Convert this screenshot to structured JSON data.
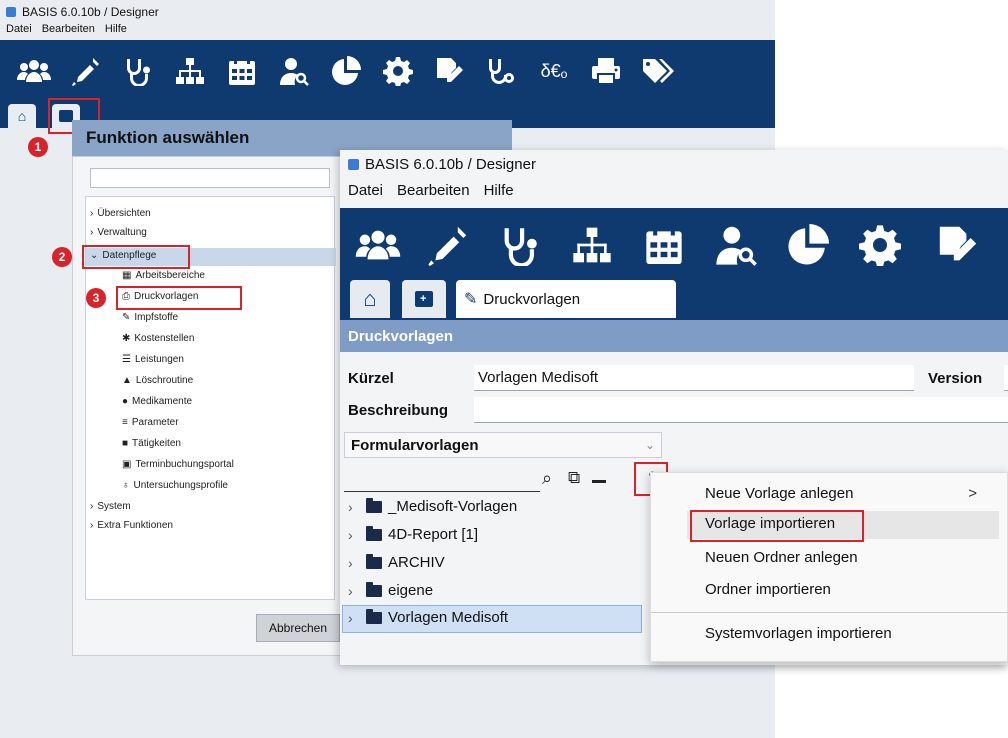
{
  "colors": {
    "toolbar": "#0e3a70",
    "highlight": "#d8232a",
    "panel": "#8aa4c7"
  },
  "back_window": {
    "title": "BASIS 6.0.10b / Designer",
    "menu": [
      "Datei",
      "Bearbeiten",
      "Hilfe"
    ],
    "toolbar_icons": [
      "users-icon",
      "syringe-icon",
      "stethoscope-icon",
      "network-icon",
      "calendar-icon",
      "doctor-search-icon",
      "pie-chart-icon",
      "gear-icon",
      "edit-doc-icon",
      "stethoscope-settings-icon",
      "currency-icon",
      "printer-icon",
      "tags-icon"
    ],
    "dialog_title": "Funktion auswählen",
    "tree": {
      "ubersichten": "Übersichten",
      "verwaltung": "Verwaltung",
      "datenpflege": "Datenpflege",
      "children": [
        "Arbeitsbereiche",
        "Druckvorlagen",
        "Impfstoffe",
        "Kostenstellen",
        "Leistungen",
        "Löschroutine",
        "Medikamente",
        "Parameter",
        "Tätigkeiten",
        "Terminbuchungsportal",
        "Untersuchungsprofile"
      ],
      "system": "System",
      "extra": "Extra Funktionen"
    },
    "cancel_button": "Abbrechen",
    "steps": [
      "1",
      "2",
      "3"
    ]
  },
  "front_window": {
    "title": "BASIS 6.0.10b / Designer",
    "menu": [
      "Datei",
      "Bearbeiten",
      "Hilfe"
    ],
    "tab_label": "Druckvorlagen",
    "section_title": "Druckvorlagen",
    "kurzel_label": "Kürzel",
    "kurzel_value": "Vorlagen Medisoft",
    "version_label": "Version",
    "beschreibung_label": "Beschreibung",
    "dropdown_value": "Formularvorlagen",
    "folders": [
      "_Medisoft-Vorlagen",
      "4D-Report [1]",
      "ARCHIV",
      "eigene",
      "Vorlagen Medisoft"
    ]
  },
  "context_menu": {
    "items": [
      "Neue Vorlage anlegen",
      "Vorlage importieren",
      "Neuen Ordner anlegen",
      "Ordner importieren",
      "Systemvorlagen importieren"
    ],
    "submenu_arrow": ">"
  }
}
